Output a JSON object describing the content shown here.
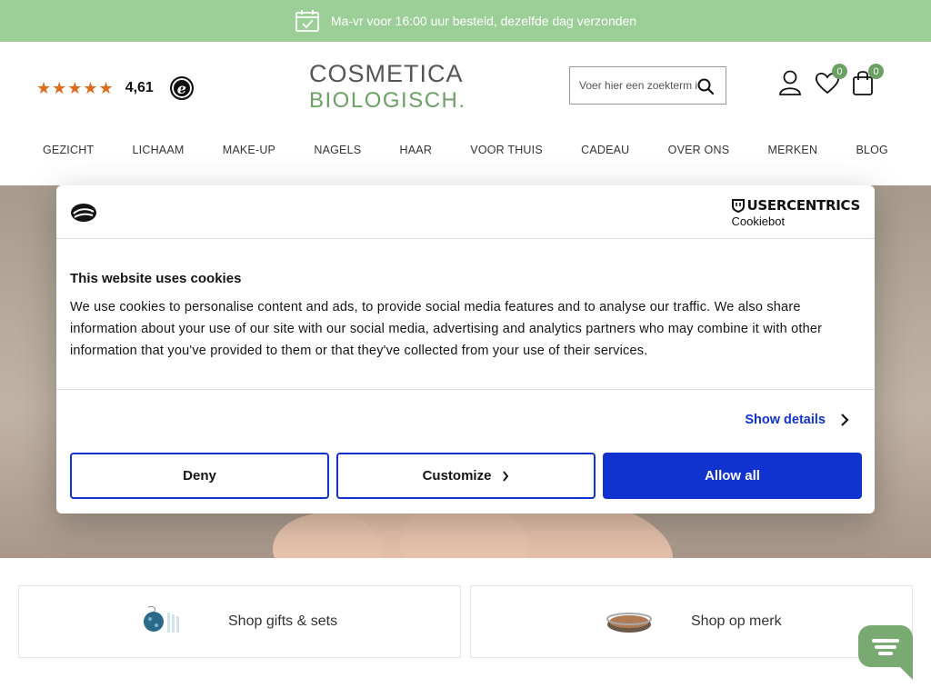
{
  "announcement": {
    "text": "Ma-vr voor 16:00 uur besteld, dezelfde dag verzonden",
    "icon": "calendar-check-icon"
  },
  "header": {
    "rating": {
      "stars": "★★★★★",
      "value": "4,61",
      "badge_letter": "e"
    },
    "logo": {
      "line1": "COSMETICA",
      "line2": "BIOLOGISCH."
    },
    "search": {
      "placeholder": "Voer hier een zoekterm in"
    },
    "wishlist_count": "0",
    "cart_count": "0"
  },
  "nav": {
    "items": [
      "GEZICHT",
      "LICHAAM",
      "MAKE-UP",
      "NAGELS",
      "HAAR",
      "VOOR THUIS",
      "CADEAU",
      "OVER ONS",
      "MERKEN",
      "BLOG"
    ]
  },
  "cookie": {
    "brand_title": "USERCENTRICS",
    "brand_sub": "Cookiebot",
    "title": "This website uses cookies",
    "body": "We use cookies to personalise content and ads, to provide social media features and to analyse our traffic. We also share information about your use of our site with our social media, advertising and analytics partners who may combine it with other information that you've provided to them or that they've collected from your use of their services.",
    "show_details": "Show details",
    "deny": "Deny",
    "customize": "Customize",
    "allow_all": "Allow all"
  },
  "tiles": [
    {
      "label": "Shop gifts & sets"
    },
    {
      "label": "Shop op merk"
    }
  ],
  "colors": {
    "green": "#9ccf98",
    "brand_green": "#6aa163",
    "blue": "#1032cf",
    "star": "#e06c1a"
  }
}
